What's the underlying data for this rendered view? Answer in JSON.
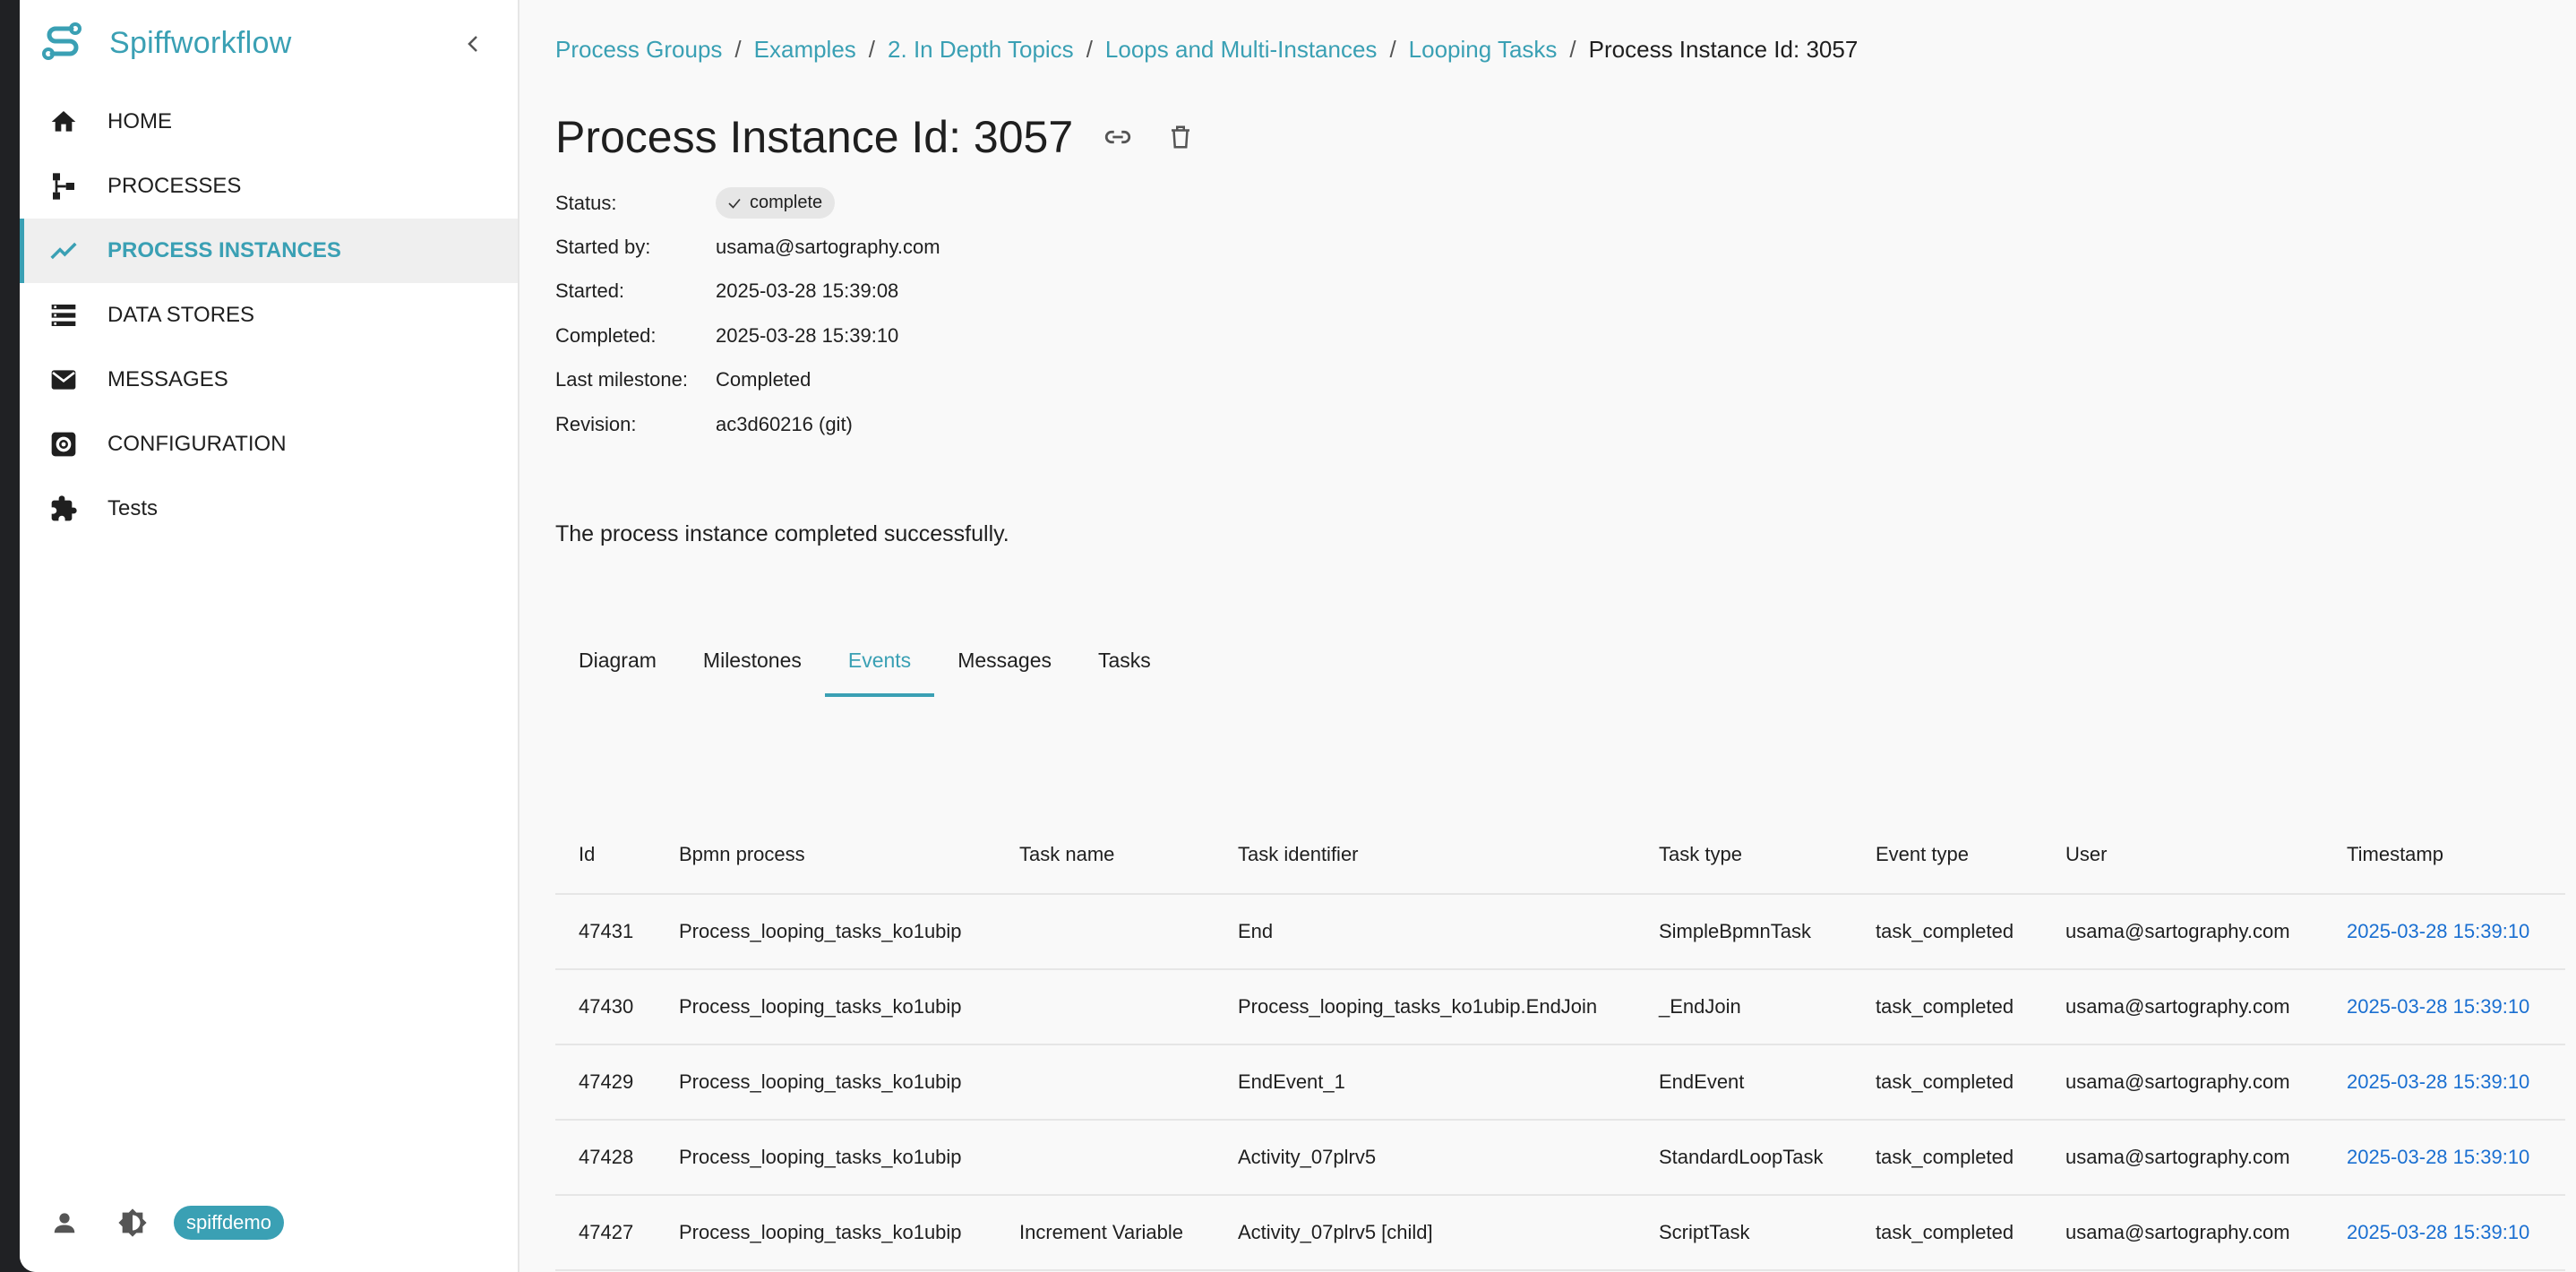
{
  "app": {
    "name": "Spiffworkflow",
    "accent": "#3aa0b4",
    "link_color": "#1a6fd1"
  },
  "sidebar": {
    "items": [
      {
        "label": "HOME",
        "icon": "home-icon",
        "active": false
      },
      {
        "label": "PROCESSES",
        "icon": "process-tree-icon",
        "active": false
      },
      {
        "label": "PROCESS INSTANCES",
        "icon": "trending-line-icon",
        "active": true
      },
      {
        "label": "DATA STORES",
        "icon": "storage-icon",
        "active": false
      },
      {
        "label": "MESSAGES",
        "icon": "envelope-icon",
        "active": false
      },
      {
        "label": "CONFIGURATION",
        "icon": "settings-box-icon",
        "active": false
      },
      {
        "label": "Tests",
        "icon": "puzzle-icon",
        "active": false
      }
    ],
    "footer": {
      "user_badge": "spiffdemo",
      "icons": [
        "person-icon",
        "brightness-icon"
      ]
    }
  },
  "breadcrumb": {
    "links": [
      "Process Groups",
      "Examples",
      "2. In Depth Topics",
      "Loops and Multi-Instances",
      "Looping Tasks"
    ],
    "current": "Process Instance Id: 3057"
  },
  "page_title": "Process Instance Id: 3057",
  "details": {
    "status_label": "Status:",
    "status_value": "complete",
    "started_by_label": "Started by:",
    "started_by_value": "usama@sartography.com",
    "started_label": "Started:",
    "started_value": "2025-03-28 15:39:08",
    "completed_label": "Completed:",
    "completed_value": "2025-03-28 15:39:10",
    "milestone_label": "Last milestone:",
    "milestone_value": "Completed",
    "revision_label": "Revision:",
    "revision_value": "ac3d60216 (git)"
  },
  "message": "The process instance completed successfully.",
  "tabs": [
    "Diagram",
    "Milestones",
    "Events",
    "Messages",
    "Tasks"
  ],
  "active_tab": "Events",
  "table": {
    "headers": [
      "Id",
      "Bpmn process",
      "Task name",
      "Task identifier",
      "Task type",
      "Event type",
      "User",
      "Timestamp"
    ],
    "rows": [
      [
        "47431",
        "Process_looping_tasks_ko1ubip",
        "",
        "End",
        "SimpleBpmnTask",
        "task_completed",
        "usama@sartography.com",
        "2025-03-28 15:39:10"
      ],
      [
        "47430",
        "Process_looping_tasks_ko1ubip",
        "",
        "Process_looping_tasks_ko1ubip.EndJoin",
        "_EndJoin",
        "task_completed",
        "usama@sartography.com",
        "2025-03-28 15:39:10"
      ],
      [
        "47429",
        "Process_looping_tasks_ko1ubip",
        "",
        "EndEvent_1",
        "EndEvent",
        "task_completed",
        "usama@sartography.com",
        "2025-03-28 15:39:10"
      ],
      [
        "47428",
        "Process_looping_tasks_ko1ubip",
        "",
        "Activity_07plrv5",
        "StandardLoopTask",
        "task_completed",
        "usama@sartography.com",
        "2025-03-28 15:39:10"
      ],
      [
        "47427",
        "Process_looping_tasks_ko1ubip",
        "Increment Variable",
        "Activity_07plrv5 [child]",
        "ScriptTask",
        "task_completed",
        "usama@sartography.com",
        "2025-03-28 15:39:10"
      ]
    ]
  }
}
